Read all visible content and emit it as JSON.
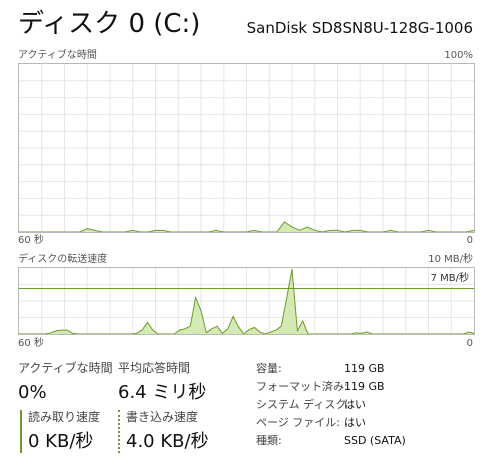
{
  "header": {
    "title": "ディスク 0 (C:)",
    "model": "SanDisk SD8SN8U-128G-1006"
  },
  "active_time_chart": {
    "label": "アクティブな時間",
    "max_label": "100%",
    "time_left": "60 秒",
    "time_right": "0",
    "color": "#6e9a2a",
    "fill": "#d4eab5"
  },
  "transfer_chart": {
    "label": "ディスクの転送速度",
    "max_label": "10 MB/秒",
    "ref_line_label": "7 MB/秒",
    "time_left": "60 秒",
    "time_right": "0",
    "color": "#6e9a2a",
    "fill": "#d4eab5"
  },
  "stats": {
    "active_time": {
      "label": "アクティブな時間",
      "value": "0%"
    },
    "avg_response": {
      "label": "平均応答時間",
      "value": "6.4 ミリ秒"
    },
    "read_speed": {
      "label": "読み取り速度",
      "value": "0 KB/秒"
    },
    "write_speed": {
      "label": "書き込み速度",
      "value": "4.0 KB/秒"
    }
  },
  "properties": [
    {
      "label": "容量:",
      "value": "119 GB"
    },
    {
      "label": "フォーマット済み:",
      "value": "119 GB"
    },
    {
      "label": "システム ディスク:",
      "value": "はい"
    },
    {
      "label": "ページ ファイル:",
      "value": "はい"
    },
    {
      "label": "種類:",
      "value": "SSD (SATA)"
    }
  ],
  "chart_data": [
    {
      "type": "area",
      "title": "アクティブな時間",
      "ylabel": "%",
      "ylim": [
        0,
        100
      ],
      "x": [
        60,
        59,
        58,
        57,
        56,
        55,
        54,
        53,
        52,
        51,
        50,
        49,
        48,
        47,
        46,
        45,
        44,
        43,
        42,
        41,
        40,
        39,
        38,
        37,
        36,
        35,
        34,
        33,
        32,
        31,
        30,
        29,
        28,
        27,
        26,
        25,
        24,
        23,
        22,
        21,
        20,
        19,
        18,
        17,
        16,
        15,
        14,
        13,
        12,
        11,
        10,
        9,
        8,
        7,
        6,
        5,
        4,
        3,
        2,
        1,
        0
      ],
      "series": [
        {
          "values": [
            0,
            0,
            0,
            0,
            0,
            0,
            0,
            0,
            0,
            2,
            1,
            0,
            0,
            0,
            0,
            1,
            0,
            0,
            1,
            1,
            0,
            0,
            0,
            0,
            0,
            0,
            1,
            0,
            0,
            0,
            0,
            1,
            0,
            0,
            0,
            6,
            3,
            1,
            3,
            1,
            0,
            1,
            1,
            0,
            1,
            1,
            0,
            0,
            0,
            1,
            0,
            0,
            0,
            0,
            1,
            0,
            0,
            0,
            0,
            0,
            1
          ]
        }
      ]
    },
    {
      "type": "area",
      "title": "ディスクの転送速度",
      "ylabel": "MB/秒",
      "ylim": [
        0,
        10
      ],
      "x": [
        60,
        59,
        58,
        57,
        56,
        55,
        54,
        53,
        52,
        51,
        50,
        49,
        48,
        47,
        46,
        45,
        44,
        43,
        42,
        41,
        40,
        39,
        38,
        37,
        36,
        35,
        34,
        33,
        32,
        31,
        30,
        29,
        28,
        27,
        26,
        25,
        24,
        23,
        22,
        21,
        20,
        19,
        18,
        17,
        16,
        15,
        14,
        13,
        12,
        11,
        10,
        9,
        8,
        7,
        6,
        5,
        4,
        3,
        2,
        1,
        0
      ],
      "series": [
        {
          "values": [
            0,
            0,
            0,
            0,
            0,
            0,
            0.2,
            0.5,
            0.6,
            0.6,
            0.1,
            0,
            0,
            0,
            0,
            0,
            0,
            0,
            0,
            0,
            0,
            0,
            0.1,
            0.6,
            1.8,
            0.6,
            0,
            0,
            0,
            0,
            0.6,
            0.8,
            1.2,
            5.6,
            3.6,
            0.2,
            0.8,
            1.2,
            0.1,
            0.8,
            2.7,
            1.1,
            0,
            0.7,
            1.0,
            0.3,
            0,
            0.3,
            0.6,
            1.2,
            5.5,
            10,
            0.5,
            2.0,
            0,
            0,
            0,
            0,
            0,
            0,
            0,
            0,
            0,
            0.2,
            0.1,
            0.3,
            0,
            0,
            0,
            0,
            0,
            0,
            0,
            0,
            0,
            0,
            0,
            0,
            0,
            0,
            0,
            0,
            0,
            0,
            0.3,
            0.1
          ]
        }
      ]
    }
  ]
}
